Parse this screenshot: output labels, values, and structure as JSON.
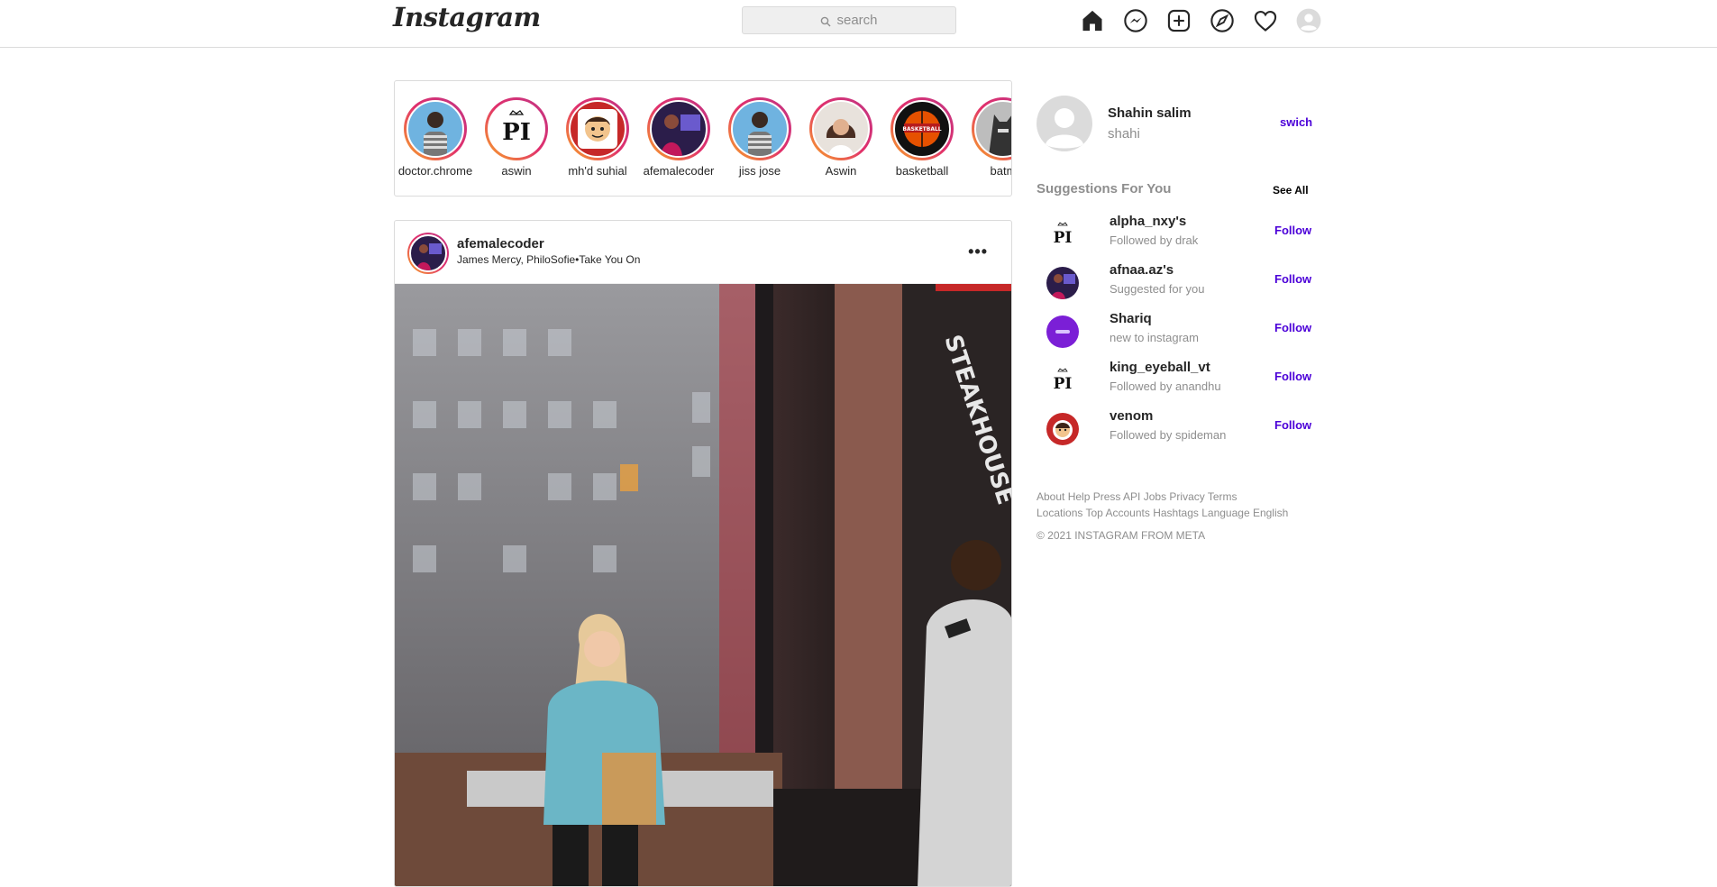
{
  "header": {
    "logo": "Instagram",
    "search_placeholder": "search",
    "icons": [
      "home-icon",
      "messenger-icon",
      "new-post-icon",
      "explore-icon",
      "activity-heart-icon",
      "profile-avatar-icon"
    ]
  },
  "stories": [
    {
      "name": "doctor.chrome",
      "avatar": "man-striped-sweater"
    },
    {
      "name": "aswin",
      "avatar": "pi-logo"
    },
    {
      "name": "mh'd suhial",
      "avatar": "cartoon-boy"
    },
    {
      "name": "afemalecoder",
      "avatar": "woman-computer"
    },
    {
      "name": "jiss jose",
      "avatar": "man-striped-sweater"
    },
    {
      "name": "Aswin",
      "avatar": "woman-portrait"
    },
    {
      "name": "basketball",
      "avatar": "basketball-logo"
    },
    {
      "name": "batm",
      "avatar": "batman"
    }
  ],
  "post": {
    "username": "afemalecoder",
    "subtitle": "James Mercy, PhiloSofie•Take You On",
    "more_label": "•••",
    "media": "street-video-frame"
  },
  "sidebar": {
    "name": "Shahin salim",
    "handle": "shahi",
    "switch_label": "swich",
    "suggestions_title": "Suggestions For You",
    "see_all_label": "See All",
    "suggestions": [
      {
        "name": "alpha_nxy's",
        "sub": "Followed by drak",
        "action": "Follow",
        "avatar": "pi-logo"
      },
      {
        "name": "afnaa.az's",
        "sub": "Suggested for you",
        "action": "Follow",
        "avatar": "woman-computer"
      },
      {
        "name": "Shariq",
        "sub": "new to instagram",
        "action": "Follow",
        "avatar": "purple-circle"
      },
      {
        "name": "king_eyeball_vt",
        "sub": "Followed by anandhu",
        "action": "Follow",
        "avatar": "pi-logo"
      },
      {
        "name": "venom",
        "sub": "Followed by spideman",
        "action": "Follow",
        "avatar": "cartoon-boy"
      }
    ],
    "footer_links_1": "About Help Press API Jobs Privacy Terms",
    "footer_links_2": "Locations Top Accounts Hashtags Language English",
    "copyright": "© 2021 INSTAGRAM FROM META"
  },
  "colors": {
    "accent": "#4b00d8",
    "border": "#dbdbdb",
    "muted": "#8e8e8e"
  }
}
